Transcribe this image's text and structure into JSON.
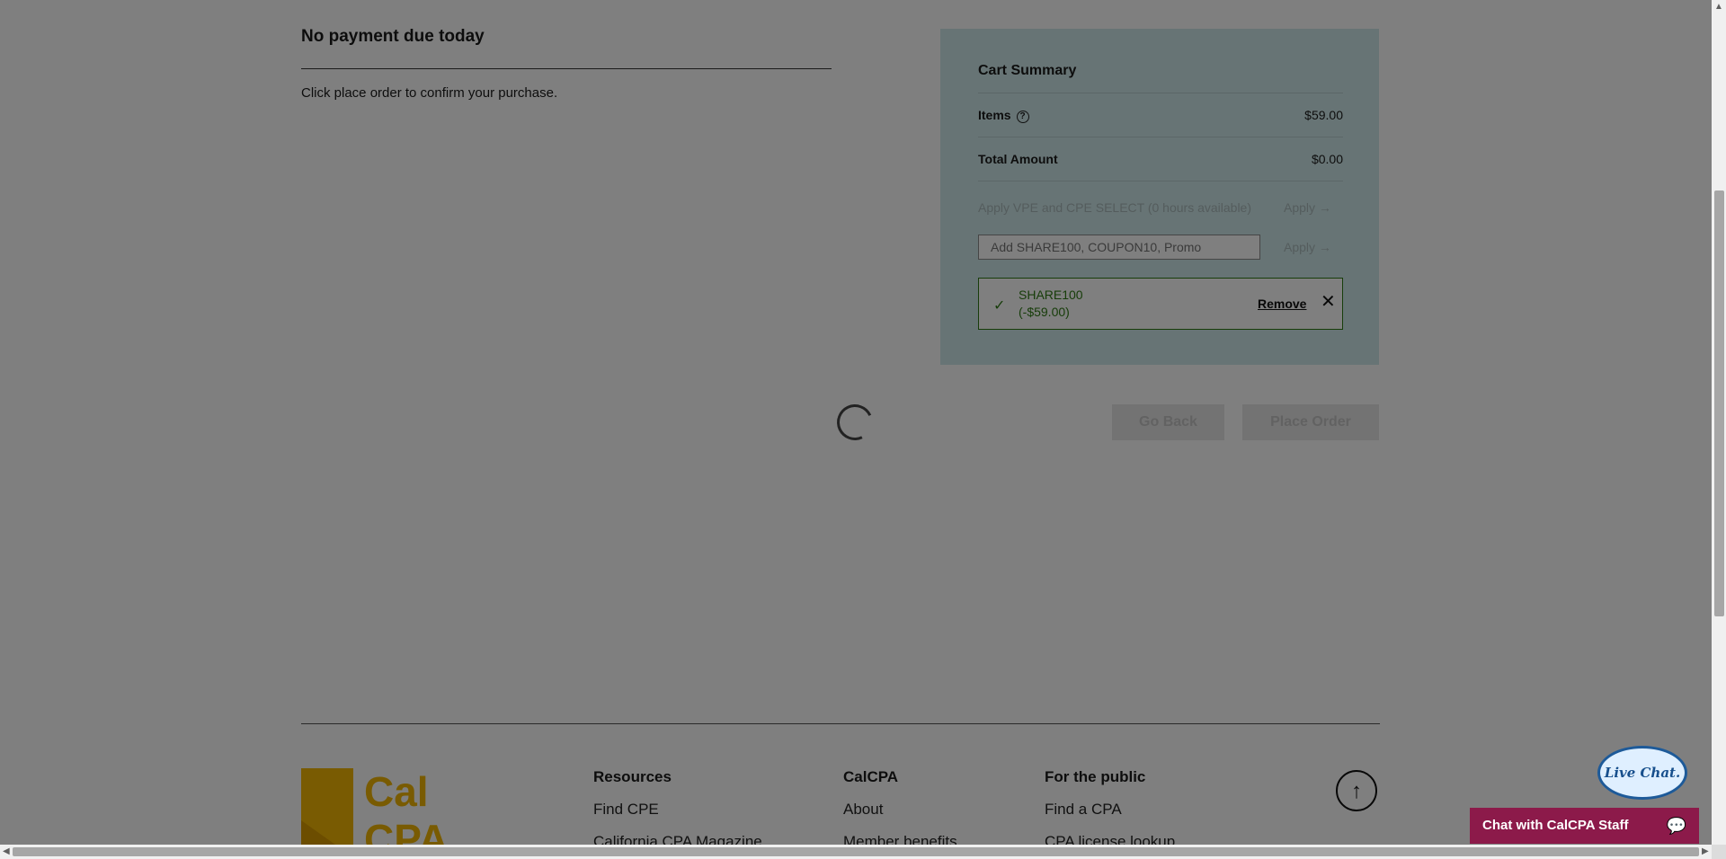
{
  "payment": {
    "title": "No payment due today",
    "confirm_text": "Click place order to confirm your purchase."
  },
  "cart": {
    "title": "Cart Summary",
    "items_label": "Items",
    "items_value": "$59.00",
    "total_label": "Total Amount",
    "total_value": "$0.00",
    "vpe_label": "Apply VPE and CPE SELECT (0 hours available)",
    "apply_label": "Apply →",
    "promo_placeholder": "Add SHARE100, COUPON10, Promo",
    "coupon": {
      "code": "SHARE100",
      "amount": "(-$59.00)",
      "remove_label": "Remove"
    }
  },
  "actions": {
    "go_back": "Go Back",
    "place_order": "Place Order"
  },
  "footer": {
    "logo_line1": "Cal",
    "logo_line2": "CPA",
    "resources": {
      "title": "Resources",
      "links": [
        "Find CPE",
        "California CPA Magazine"
      ]
    },
    "calcpa": {
      "title": "CalCPA",
      "links": [
        "About",
        "Member benefits"
      ]
    },
    "public": {
      "title": "For the public",
      "links": [
        "Find a CPA",
        "CPA license lookup"
      ]
    }
  },
  "chat": {
    "bubble": "Live Chat.",
    "bar_label": "Chat with CalCPA Staff"
  },
  "colors": {
    "cart_bg": "#cfe9ea",
    "coupon_green": "#2f7a14",
    "chat_bar": "#8c1a4a",
    "logo_gold": "#f2b705"
  }
}
